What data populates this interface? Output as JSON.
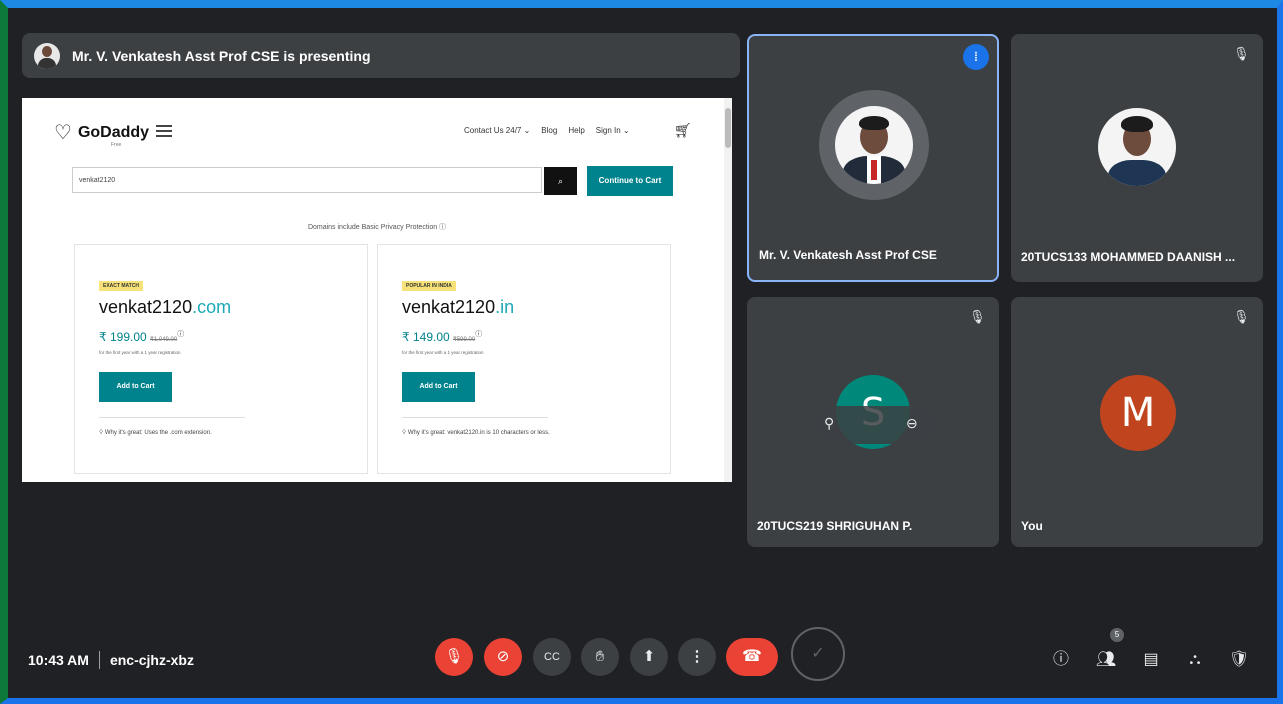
{
  "presenting": {
    "text": "Mr. V. Venkatesh Asst Prof CSE is presenting"
  },
  "shared_screen": {
    "brand": "GoDaddy",
    "brand_sub": "Free",
    "nav": [
      "Contact Us 24/7 ⌄",
      "Blog",
      "Help",
      "Sign In ⌄"
    ],
    "search_value": "venkat2120",
    "continue_label": "Continue to Cart",
    "privacy_note": "Domains include Basic Privacy Protection ⓘ",
    "cards": [
      {
        "tag": "EXACT MATCH",
        "domain_name": "venkat2120",
        "tld": ".com",
        "price": "₹ 199.00",
        "old_price": "₹1,049.00",
        "note": "for the first year with a 1 year registration",
        "button": "Add to Cart",
        "why": "Why it's great: Uses the .com extension."
      },
      {
        "tag": "POPULAR IN INDIA",
        "domain_name": "venkat2120",
        "tld": ".in",
        "price": "₹ 149.00",
        "old_price": "₹599.00",
        "note": "for the first year with a 1 year registration",
        "button": "Add to Cart",
        "why": "Why it's great: venkat2120.in is 10 characters or less."
      }
    ]
  },
  "participants": [
    {
      "name": "Mr. V. Venkatesh Asst Prof CSE",
      "speaking": true
    },
    {
      "name": "20TUCS133 MOHAMMED DAANISH ..."
    },
    {
      "name": "20TUCS219 SHRIGUHAN P.",
      "initial": "S",
      "avatar_color": "#00897b"
    },
    {
      "name": "You",
      "initial": "M",
      "avatar_color": "#c0451e"
    }
  ],
  "meeting": {
    "time": "10:43 AM",
    "code": "enc-cjhz-xbz",
    "participant_count": "5"
  },
  "icons": {
    "mic": "mic-off-icon",
    "camera": "camera-off-icon",
    "captions": "captions-icon",
    "hand": "raise-hand-icon",
    "present": "present-icon",
    "more": "more-options-icon",
    "end": "end-call-icon",
    "info": "info-icon",
    "people": "people-icon",
    "chat": "chat-icon",
    "activities": "activities-icon",
    "host": "host-controls-icon"
  }
}
